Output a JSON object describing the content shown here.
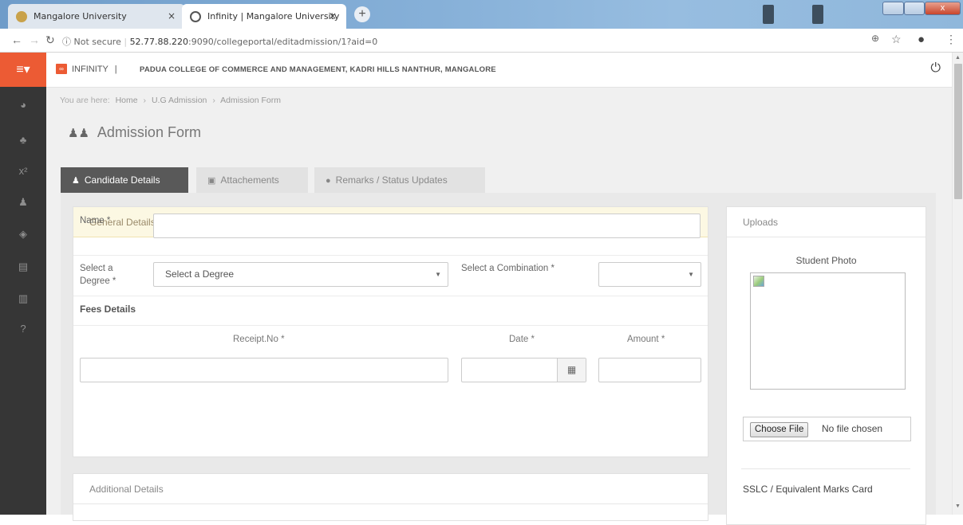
{
  "browser": {
    "tabs": [
      {
        "title": "Mangalore University",
        "active": false
      },
      {
        "title": "Infinity | Mangalore University",
        "active": true
      }
    ],
    "new_tab_symbol": "+",
    "close_symbol": "×",
    "security": "Not secure",
    "url_host": "52.77.88.220",
    "url_path": ":9090/collegeportal/editadmission/1?aid=0",
    "window_close": "x",
    "icons": [
      "back-icon",
      "forward-icon",
      "reload-icon",
      "info-icon",
      "zoom-icon",
      "star-icon",
      "profile-icon",
      "menu-icon"
    ]
  },
  "app": {
    "brand": "INFINITY",
    "brand_sep": "|",
    "college": "PADUA COLLEGE OF COMMERCE AND MANAGEMENT, KADRI HILLS NANTHUR, MANGALORE",
    "accent": "#ec5b34",
    "sidebar_color": "#363636"
  },
  "breadcrumb": {
    "prefix": "You are here:",
    "items": [
      "Home",
      "U.G Admission",
      "Admission Form"
    ],
    "sep": "›"
  },
  "page": {
    "title": "Admission Form"
  },
  "tabs": [
    {
      "label": "Candidate Details",
      "icon": "user-icon",
      "active": true
    },
    {
      "label": "Attachements",
      "icon": "image-icon",
      "active": false
    },
    {
      "label": "Remarks / Status Updates",
      "icon": "comment-icon",
      "active": false
    }
  ],
  "general": {
    "heading": "General Details",
    "name_label": "Name *",
    "name_value": "",
    "degree_label_1": "Select a",
    "degree_label_2": "Degree *",
    "degree_selected": "Select a Degree",
    "combination_label": "Select a Combination *",
    "combination_selected": "",
    "fees_title": "Fees Details",
    "receipt_header": "Receipt.No *",
    "date_header": "Date *",
    "amount_header": "Amount *"
  },
  "additional": {
    "heading": "Additional Details"
  },
  "uploads": {
    "heading": "Uploads",
    "photo_label": "Student Photo",
    "choose_file": "Choose File",
    "no_file": "No file chosen",
    "sslc_label": "SSLC / Equivalent Marks Card"
  }
}
